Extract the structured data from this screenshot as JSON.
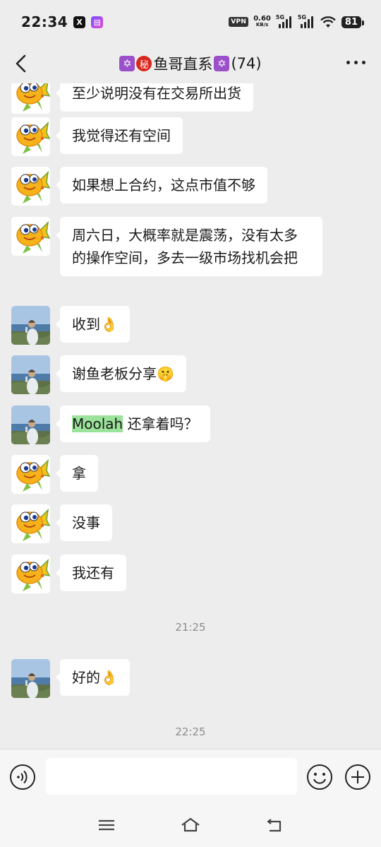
{
  "status_bar": {
    "time": "22:34",
    "apps": [
      "X",
      "pay"
    ],
    "vpn": "VPN",
    "speed_value": "0.60",
    "speed_unit": "KB/s",
    "net1": "5G",
    "net2": "5G",
    "battery": "81"
  },
  "header": {
    "title_name": "鱼哥直系",
    "title_count": "(74)",
    "badge_mi": "秘",
    "badge_star": "✡"
  },
  "messages": [
    {
      "sender": "fish",
      "text": "至少说明没有在交易所出货"
    },
    {
      "sender": "fish",
      "text": "我觉得还有空间"
    },
    {
      "sender": "fish",
      "text": "如果想上合约，这点市值不够"
    },
    {
      "sender": "fish",
      "text": "周六日，大概率就是震荡，没有太多的操作空间，多去一级市场找机会把"
    },
    {
      "sender": "user",
      "text": "收到",
      "emoji": "👌"
    },
    {
      "sender": "user",
      "text": "谢鱼老板分享",
      "emoji": "🤫"
    },
    {
      "sender": "user",
      "highlight": "Moolah",
      "text": " 还拿着吗？"
    },
    {
      "sender": "fish",
      "text": "拿"
    },
    {
      "sender": "fish",
      "text": "没事"
    },
    {
      "sender": "fish",
      "text": "我还有"
    },
    {
      "sender": "user",
      "text": "好的",
      "emoji": "👌"
    }
  ],
  "timestamps": [
    "21:25",
    "22:25"
  ],
  "input": {
    "placeholder": ""
  },
  "icons": [
    "back-icon",
    "more-icon",
    "voice-icon",
    "emoji-icon",
    "plus-icon",
    "menu-icon",
    "home-icon",
    "return-icon"
  ]
}
